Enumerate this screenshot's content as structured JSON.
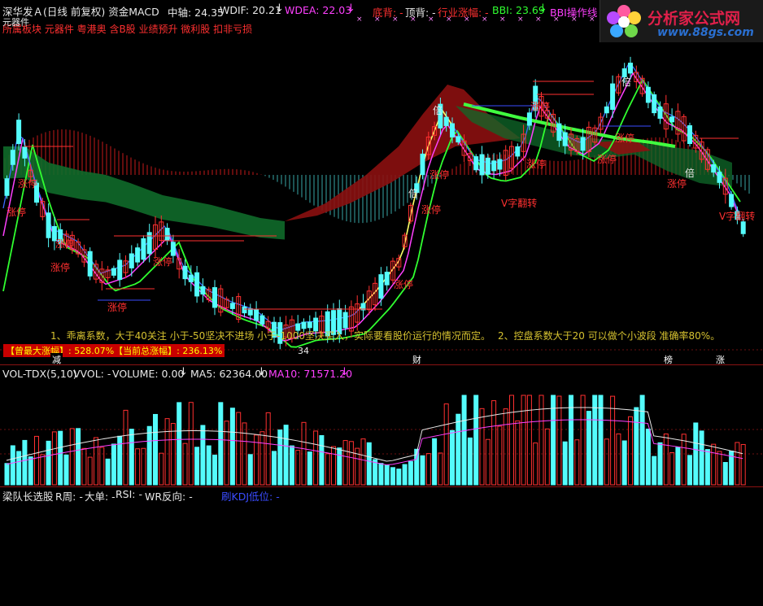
{
  "main_header": {
    "title": "深华发Ａ(日线 前复权)",
    "indicator": "资金MACD",
    "zhongzhou": "中轴: 24.35",
    "wdif": "WDIF: 20.21",
    "wdea": "WDEA: 22.03",
    "dibei": "底背: -",
    "dingbei": "顶背: -",
    "hangye": "行业涨幅: -",
    "bbi": "BBI: 23.69",
    "bbi_op": "BBI操作线"
  },
  "sector_line": "所属板块 元器件 粤港奥 含B股 业绩预升 微利股 扣非亏损",
  "sector_label": "元器件",
  "annotation_1": "1、乖离系数，大于40关注 小于-50坚决不进场 小于-1000坚决买入，实际要看股价运行的情况而定。",
  "annotation_2": "2、控盘系数大于20 可以做个小波段 准确率80%。",
  "stat_bar": "【曾最大涨幅】: 528.07%【当前总涨幅】: 236.13%",
  "low_marker": "34",
  "x_markers": [
    "减",
    "财",
    "榜",
    "涨"
  ],
  "chart_tags": {
    "zhangting": "涨停",
    "bei": "倍",
    "vfanzhuan": "V字翻转"
  },
  "logo": {
    "brand": "分析家公式网",
    "url": "www.88gs.com"
  },
  "vol_header": {
    "name": "VOL-TDX(5,10)",
    "vvol": "VVOL: -",
    "volume": "VOLUME: 0.00",
    "ma5": "MA5: 62364.00",
    "ma10": "MA10: 71571.20"
  },
  "sub_header": {
    "name": "梁队长选股",
    "r_week": "R周: -",
    "dadan": "大单: -",
    "rsi": "RSI: -",
    "wr": "WR反向: -",
    "dj": "刷KDJ低位: -"
  },
  "colors": {
    "up": "#ff3030",
    "down": "#54fcfc",
    "ma_green": "#30ff30",
    "ma_magenta": "#ff40ff",
    "ma_yellow": "#ffff60",
    "cloud_red": "#8b1010",
    "cloud_green": "#0f6a2a",
    "accent_text": "#ff40ff"
  }
}
